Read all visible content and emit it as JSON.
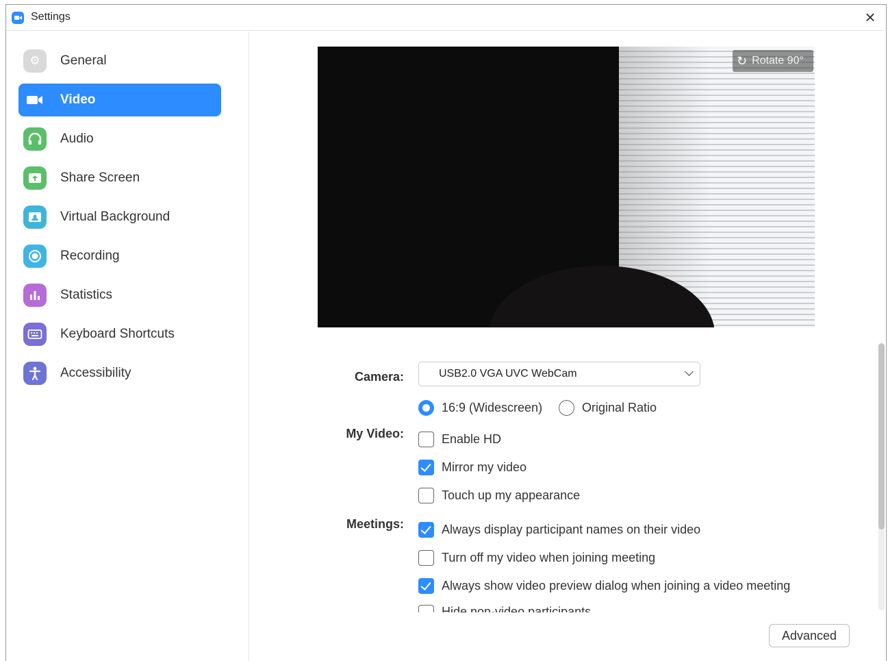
{
  "window": {
    "title": "Settings",
    "close_icon": "close-icon"
  },
  "sidebar": {
    "items": [
      {
        "label": "General",
        "icon": "gear-icon",
        "color": "#d7d7d7"
      },
      {
        "label": "Video",
        "icon": "video-camera-icon",
        "color": "#2d8cff",
        "active": true
      },
      {
        "label": "Audio",
        "icon": "headphones-icon",
        "color": "#5bbf6a"
      },
      {
        "label": "Share Screen",
        "icon": "share-screen-icon",
        "color": "#5bbf6a"
      },
      {
        "label": "Virtual Background",
        "icon": "virtual-background-icon",
        "color": "#3fb5d9"
      },
      {
        "label": "Recording",
        "icon": "record-icon",
        "color": "#3fb5e6"
      },
      {
        "label": "Statistics",
        "icon": "bar-chart-icon",
        "color": "#b76bd6"
      },
      {
        "label": "Keyboard Shortcuts",
        "icon": "keyboard-icon",
        "color": "#7a6fd6"
      },
      {
        "label": "Accessibility",
        "icon": "accessibility-icon",
        "color": "#6d74d6"
      }
    ]
  },
  "preview": {
    "rotate_label": "Rotate 90°"
  },
  "labels": {
    "camera": "Camera:",
    "my_video": "My Video:",
    "meetings": "Meetings:"
  },
  "camera": {
    "selected": "USB2.0 VGA UVC WebCam"
  },
  "aspect": {
    "widescreen": {
      "label": "16:9 (Widescreen)",
      "selected": true
    },
    "original": {
      "label": "Original Ratio",
      "selected": false
    }
  },
  "my_video": {
    "enable_hd": {
      "label": "Enable HD",
      "checked": false
    },
    "mirror": {
      "label": "Mirror my video",
      "checked": true
    },
    "touch_up": {
      "label": "Touch up my appearance",
      "checked": false
    }
  },
  "meetings": {
    "display_names": {
      "label": "Always display participant names on their video",
      "checked": true
    },
    "turn_off_video": {
      "label": "Turn off my video when joining meeting",
      "checked": false
    },
    "show_preview": {
      "label": "Always show video preview dialog when joining a video meeting",
      "checked": true
    },
    "hide_non_video": {
      "label": "Hide non-video participants",
      "checked": false
    }
  },
  "advanced_label": "Advanced",
  "accent_color": "#2d8cff"
}
